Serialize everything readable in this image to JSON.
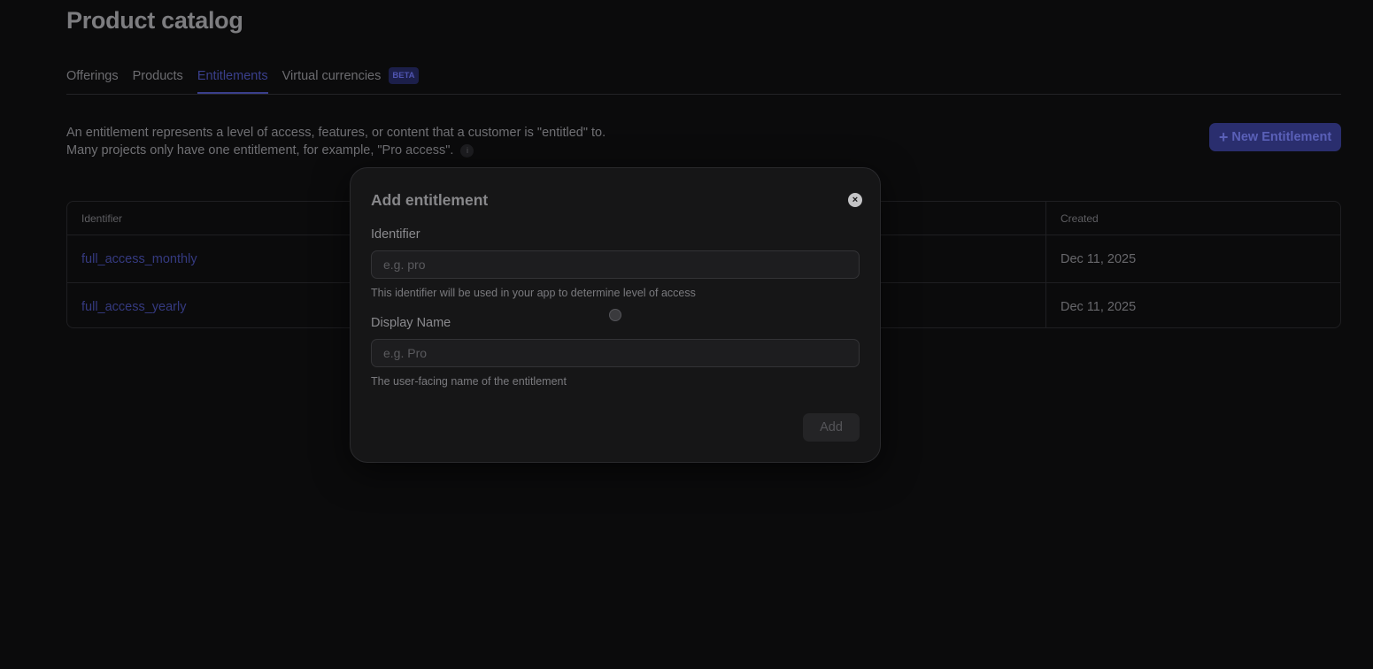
{
  "page": {
    "title": "Product catalog",
    "tabs": [
      {
        "label": "Offerings",
        "active": false
      },
      {
        "label": "Products",
        "active": false
      },
      {
        "label": "Entitlements",
        "active": true
      },
      {
        "label": "Virtual currencies",
        "active": false,
        "badge": "BETA"
      }
    ],
    "description_line1": "An entitlement represents a level of access, features, or content that a customer is \"entitled\" to.",
    "description_line2": "Many projects only have one entitlement, for example, \"Pro access\".",
    "info_glyph": "i",
    "new_button": {
      "icon": "plus-icon",
      "glyph": "+",
      "label": "New Entitlement"
    }
  },
  "table": {
    "columns": [
      "Identifier",
      "Created"
    ],
    "rows": [
      {
        "identifier": "full_access_monthly",
        "created": "Dec 11, 2025"
      },
      {
        "identifier": "full_access_yearly",
        "created": "Dec 11, 2025"
      }
    ]
  },
  "modal": {
    "title": "Add entitlement",
    "close_icon": "close-icon",
    "close_glyph": "×",
    "identifier": {
      "label": "Identifier",
      "value": "",
      "placeholder": "e.g. pro",
      "help": "This identifier will be used in your app to determine level of access"
    },
    "display_name": {
      "label": "Display Name",
      "value": "",
      "placeholder": "e.g. Pro",
      "help": "The user-facing name of the entitlement"
    },
    "add_label": "Add"
  },
  "colors": {
    "accent": "#3a3f8c",
    "background": "#0b0b0c",
    "modal_background": "#161617"
  }
}
